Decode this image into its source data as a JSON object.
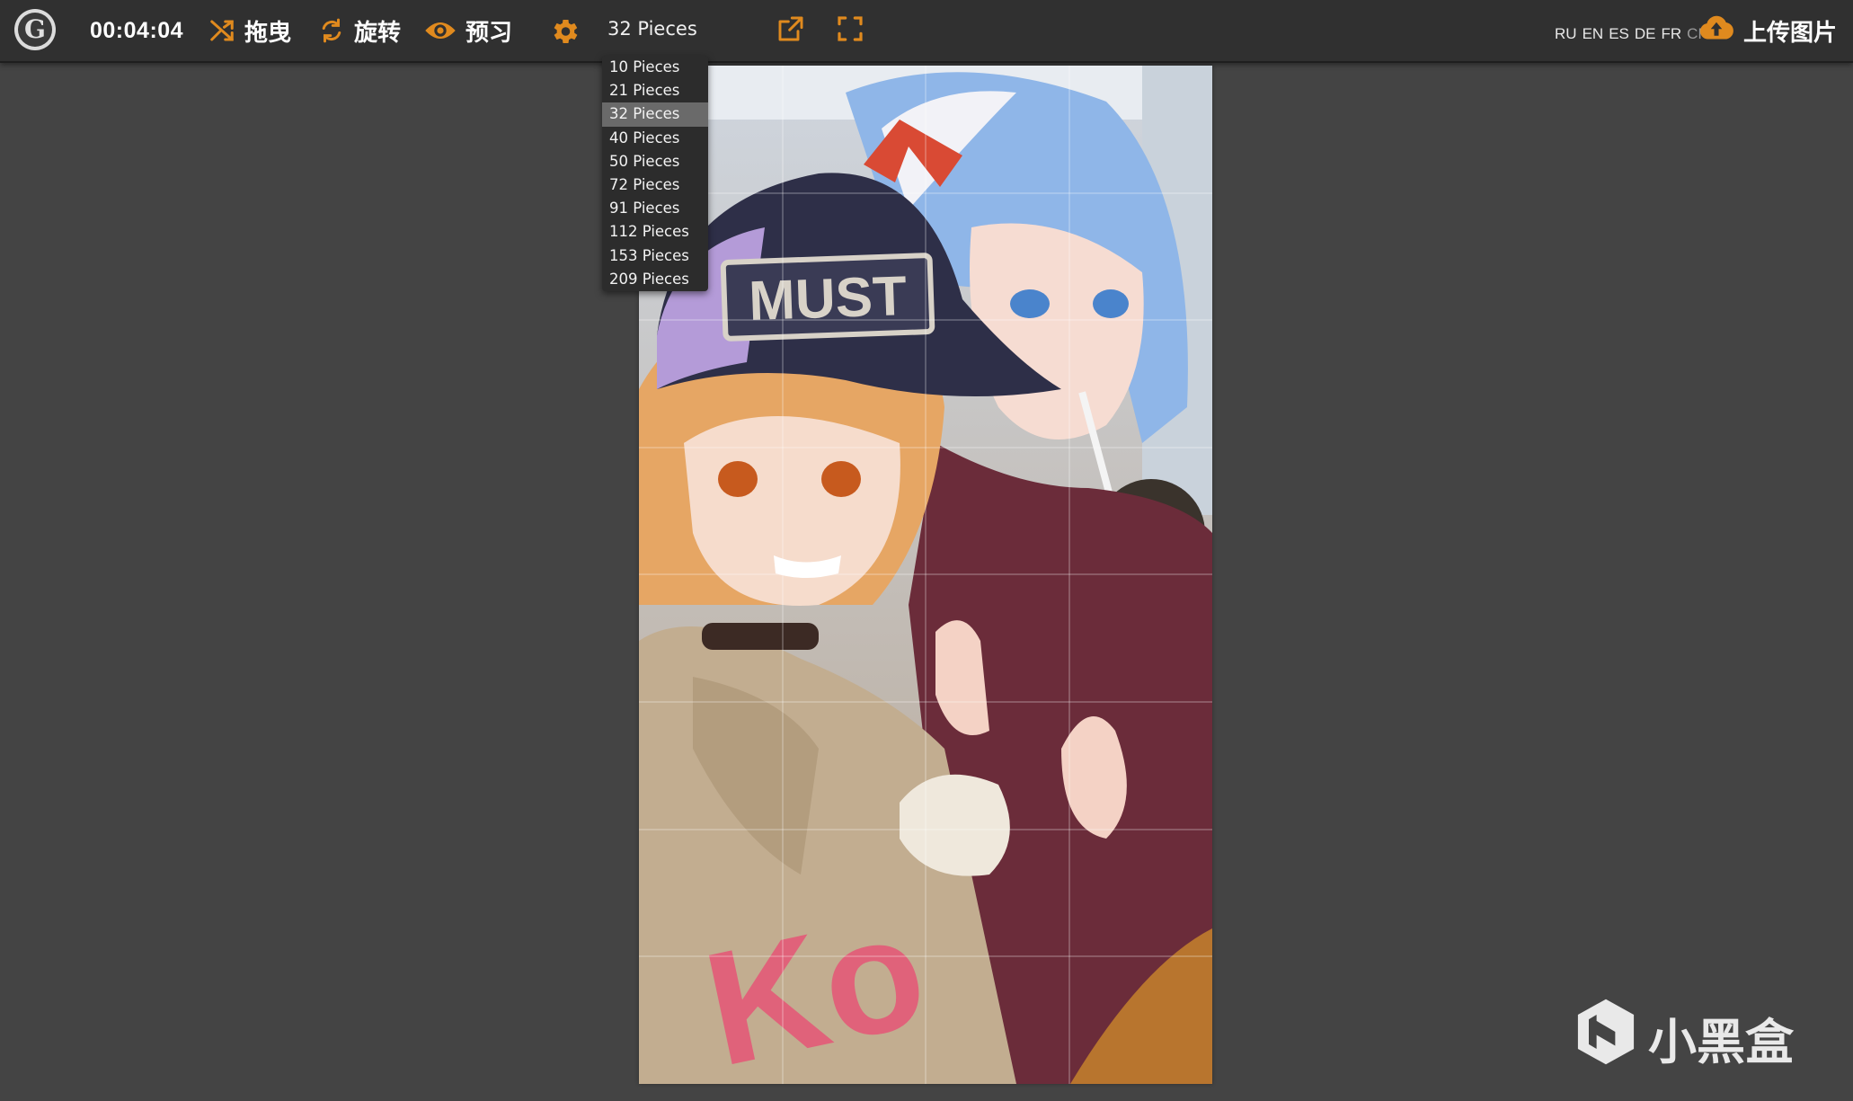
{
  "toolbar": {
    "timer": "00:04:04",
    "tools": [
      {
        "label": "拖曳",
        "icon": "shuffle-icon"
      },
      {
        "label": "旋转",
        "icon": "rotate-icon"
      },
      {
        "label": "预习",
        "icon": "eye-icon"
      }
    ],
    "settings_icon": "gear-icon",
    "pieces_selected": "32 Pieces",
    "open_external_icon": "external-link-icon",
    "fullscreen_icon": "fullscreen-icon",
    "languages": [
      "RU",
      "EN",
      "ES",
      "DE",
      "FR",
      "CN"
    ],
    "active_language": "CN",
    "upload_label": "上传图片",
    "upload_icon": "cloud-upload-icon"
  },
  "dropdown": {
    "options": [
      "10 Pieces",
      "21 Pieces",
      "32 Pieces",
      "40 Pieces",
      "50 Pieces",
      "72 Pieces",
      "91 Pieces",
      "112 Pieces",
      "153 Pieces",
      "209 Pieces"
    ],
    "selected_index": 2
  },
  "puzzle": {
    "cap_text": "MUST",
    "hoodie_text": "Ko"
  },
  "watermark": {
    "text": "小黑盒"
  },
  "colors": {
    "accent": "#e08a1e",
    "toolbar_bg": "#303030",
    "workspace_bg": "#444444"
  }
}
